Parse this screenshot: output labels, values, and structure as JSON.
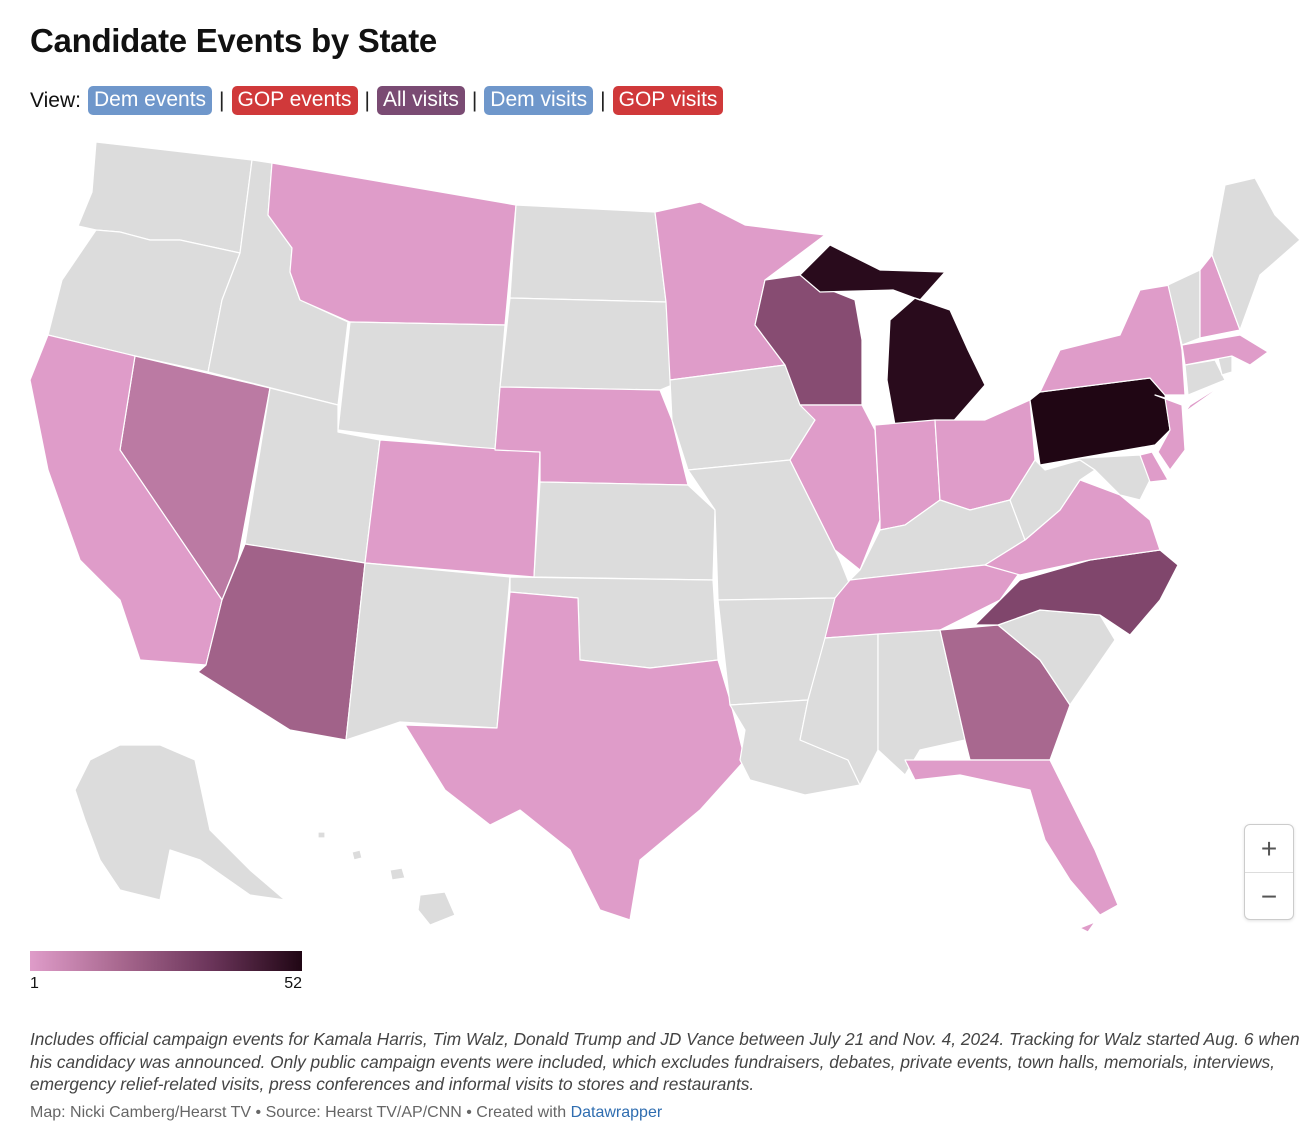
{
  "title": "Candidate Events by State",
  "view": {
    "label": "View:",
    "separator": "|",
    "options": [
      {
        "label": "Dem events",
        "color": "#6f97cb"
      },
      {
        "label": "GOP events",
        "color": "#d0393a"
      },
      {
        "label": "All visits",
        "color": "#7a4b73"
      },
      {
        "label": "Dem visits",
        "color": "#6f97cb"
      },
      {
        "label": "GOP visits",
        "color": "#d0393a"
      }
    ]
  },
  "map": {
    "no_data_color": "#dcdcdc",
    "color_scale": [
      "#df9cc9",
      "#a8688f",
      "#6a3459",
      "#200614"
    ],
    "values_by_state": {
      "MT": 1,
      "MN": 1,
      "NE": 1,
      "CO": 1,
      "CA": 1,
      "TX": 1,
      "IL": 1,
      "IN": 1,
      "OH": 1,
      "NY": 1,
      "NH": 1,
      "MA": 1,
      "NJ": 1,
      "VA": 1,
      "TN": 1,
      "FL": 1,
      "DE": 1,
      "NV": 12,
      "AZ": 20,
      "GA": 18,
      "WI": 27,
      "NC": 29,
      "MI": 50,
      "PA": 52
    }
  },
  "zoom": {
    "in_label": "+",
    "out_label": "−"
  },
  "legend": {
    "min": 1,
    "max": 52,
    "min_label": "1",
    "max_label": "52"
  },
  "note": "Includes official campaign events for Kamala Harris, Tim Walz, Donald Trump and JD Vance between July 21 and Nov. 4, 2024. Tracking for Walz started Aug. 6 when his candidacy was announced. Only public campaign events were included, which excludes fundraisers, debates, private events, town halls, memorials, interviews, emergency relief-related visits, press conferences and informal visits to stores and restaurants.",
  "source": {
    "text": "Map: Nicki Camberg/Hearst TV • Source: Hearst TV/AP/CNN • Created with ",
    "link_text": "Datawrapper"
  }
}
